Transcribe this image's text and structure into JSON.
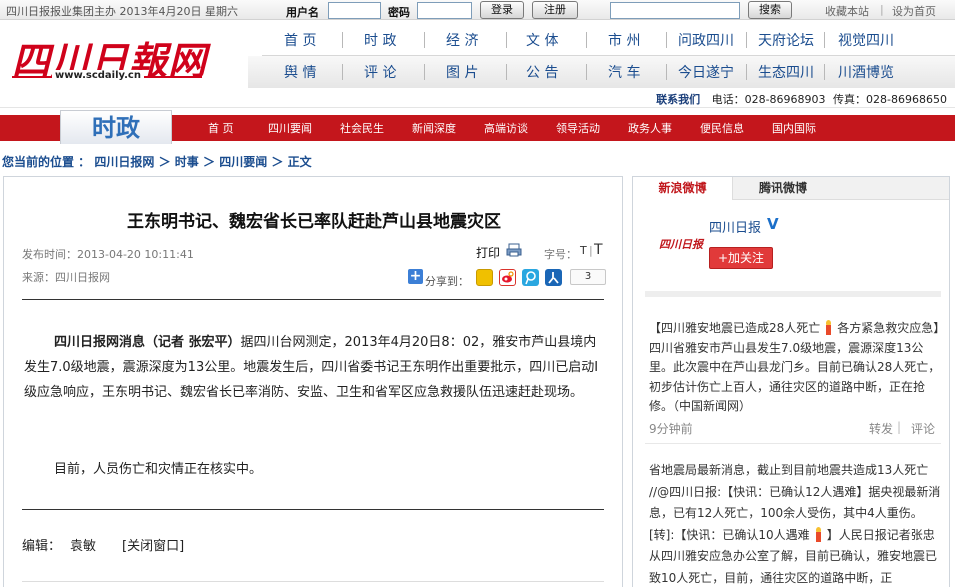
{
  "topbar": {
    "info": "四川日报报业集团主办 2013年4月20日 星期六",
    "username_label": "用户名",
    "password_label": "密码",
    "login_button": "登录",
    "register_button": "注册",
    "search_button": "搜索",
    "favorite_link": "收藏本站",
    "homepage_link": "设为首页",
    "separator": "|"
  },
  "logo": {
    "title": "四川日報网",
    "url": "www.scdaily.cn"
  },
  "nav_row1": [
    "首 页",
    "时 政",
    "经 济",
    "文 体",
    "市 州",
    "问政四川",
    "天府论坛",
    "视觉四川"
  ],
  "nav_row2": [
    "舆 情",
    "评 论",
    "图 片",
    "公 告",
    "汽 车",
    "今日遂宁",
    "生态四川",
    "川酒博览"
  ],
  "contact": {
    "label": "联系我们",
    "phone_label": "电话：",
    "phone": "028-86968903",
    "fax_label": "传真：",
    "fax": "028-86968650"
  },
  "channel": {
    "title": "时政"
  },
  "red_nav": [
    "首 页",
    "四川要闻",
    "社会民生",
    "新闻深度",
    "高端访谈",
    "领导活动",
    "政务人事",
    "便民信息",
    "国内国际"
  ],
  "breadcrumb": {
    "label": "您当前的位置 ：",
    "items": [
      "四川日报网",
      "时事",
      "四川要闻",
      "正文"
    ],
    "sep": "＞"
  },
  "article": {
    "title": "王东明书记、魏宏省长已率队赶赴芦山县地震灾区",
    "published": "发布时间：2013-04-20 10:11:41",
    "source": "来源：四川日报网",
    "print_label": "打印",
    "font_label": "字号：",
    "font_small": "T",
    "font_sep": "|",
    "font_large": "T",
    "share_label": "分享到：",
    "share_count": "3",
    "p1_lead": "四川日报网消息（记者 张宏平）",
    "p1_body": "据四川台网测定，2013年4月20日8：02，雅安市芦山县境内发生7.0级地震，震源深度为13公里。地震发生后，四川省委书记王东明作出重要批示，四川已启动Ⅰ级应急响应，王东明书记、魏宏省长已率消防、安监、卫生和省军区应急救援队伍迅速赶赴现场。",
    "p2": "目前，人员伤亡和灾情正在核实中。",
    "editor_label": "编辑：",
    "editor": "袁敏",
    "close_link": "[关闭窗口]"
  },
  "sidebar": {
    "tab_sina": "新浪微博",
    "tab_tencent": "腾讯微博",
    "account_name": "四川日报",
    "logo_text": "四川日报",
    "verified_mark": "V",
    "follow_button": "+加关注",
    "post1_a": "【四川雅安地震已造成28人死亡",
    "post1_b": "各方紧急救灾应急】四川省雅安市芦山县发生7.0级地震，震源深度13公里。此次震中在芦山县龙门乡。目前已确认28人死亡，初步估计伤亡上百人，通往灾区的道路中断，正在抢修。（中国新闻网）",
    "post1_time": "9分钟前",
    "repost": "转发",
    "comment": "评论",
    "post2_a": "省地震局最新消息，截止到目前地震共造成13人死亡 //@四川日报:【快讯：已确认12人遇难】据央视最新消息，已有12人死亡，100余人受伤，其中4人重伤。[转]:【快讯：已确认10人遇难",
    "post2_b": "】人民日报记者张忠从四川雅安应急办公室了解，目前已确认，雅安地震已致10人死亡，目前，通往灾区的道路中断，正"
  }
}
